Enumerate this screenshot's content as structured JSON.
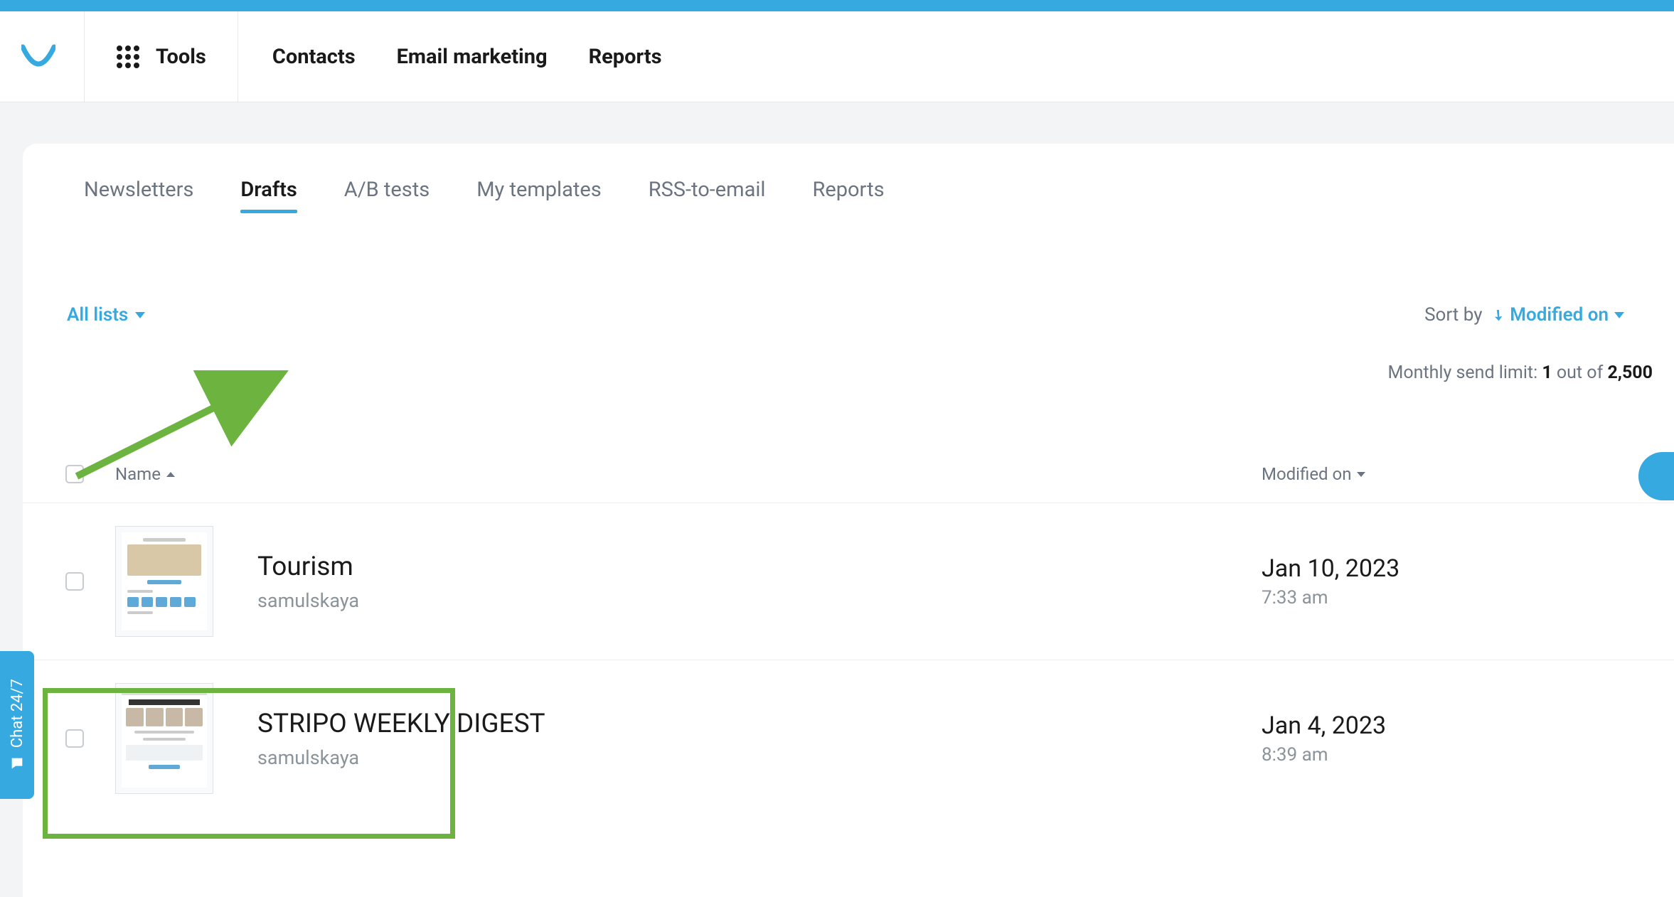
{
  "header": {
    "tools_label": "Tools",
    "nav": [
      "Contacts",
      "Email marketing",
      "Reports"
    ]
  },
  "tabs": {
    "items": [
      "Newsletters",
      "Drafts",
      "A/B tests",
      "My templates",
      "RSS-to-email",
      "Reports"
    ],
    "active_index": 1
  },
  "filters": {
    "all_lists": "All lists",
    "sort_by_label": "Sort by",
    "sort_value": "Modified on"
  },
  "limit": {
    "prefix": "Monthly send limit:",
    "current": "1",
    "of": "out of",
    "total": "2,500"
  },
  "table": {
    "col_name": "Name",
    "col_modified": "Modified on",
    "rows": [
      {
        "title": "Tourism",
        "author": "samulskaya",
        "date": "Jan 10, 2023",
        "time": "7:33 am"
      },
      {
        "title": "STRIPO WEEKLY DIGEST",
        "author": "samulskaya",
        "date": "Jan 4, 2023",
        "time": "8:39 am"
      }
    ]
  },
  "chat": {
    "label": "Chat 24/7"
  }
}
